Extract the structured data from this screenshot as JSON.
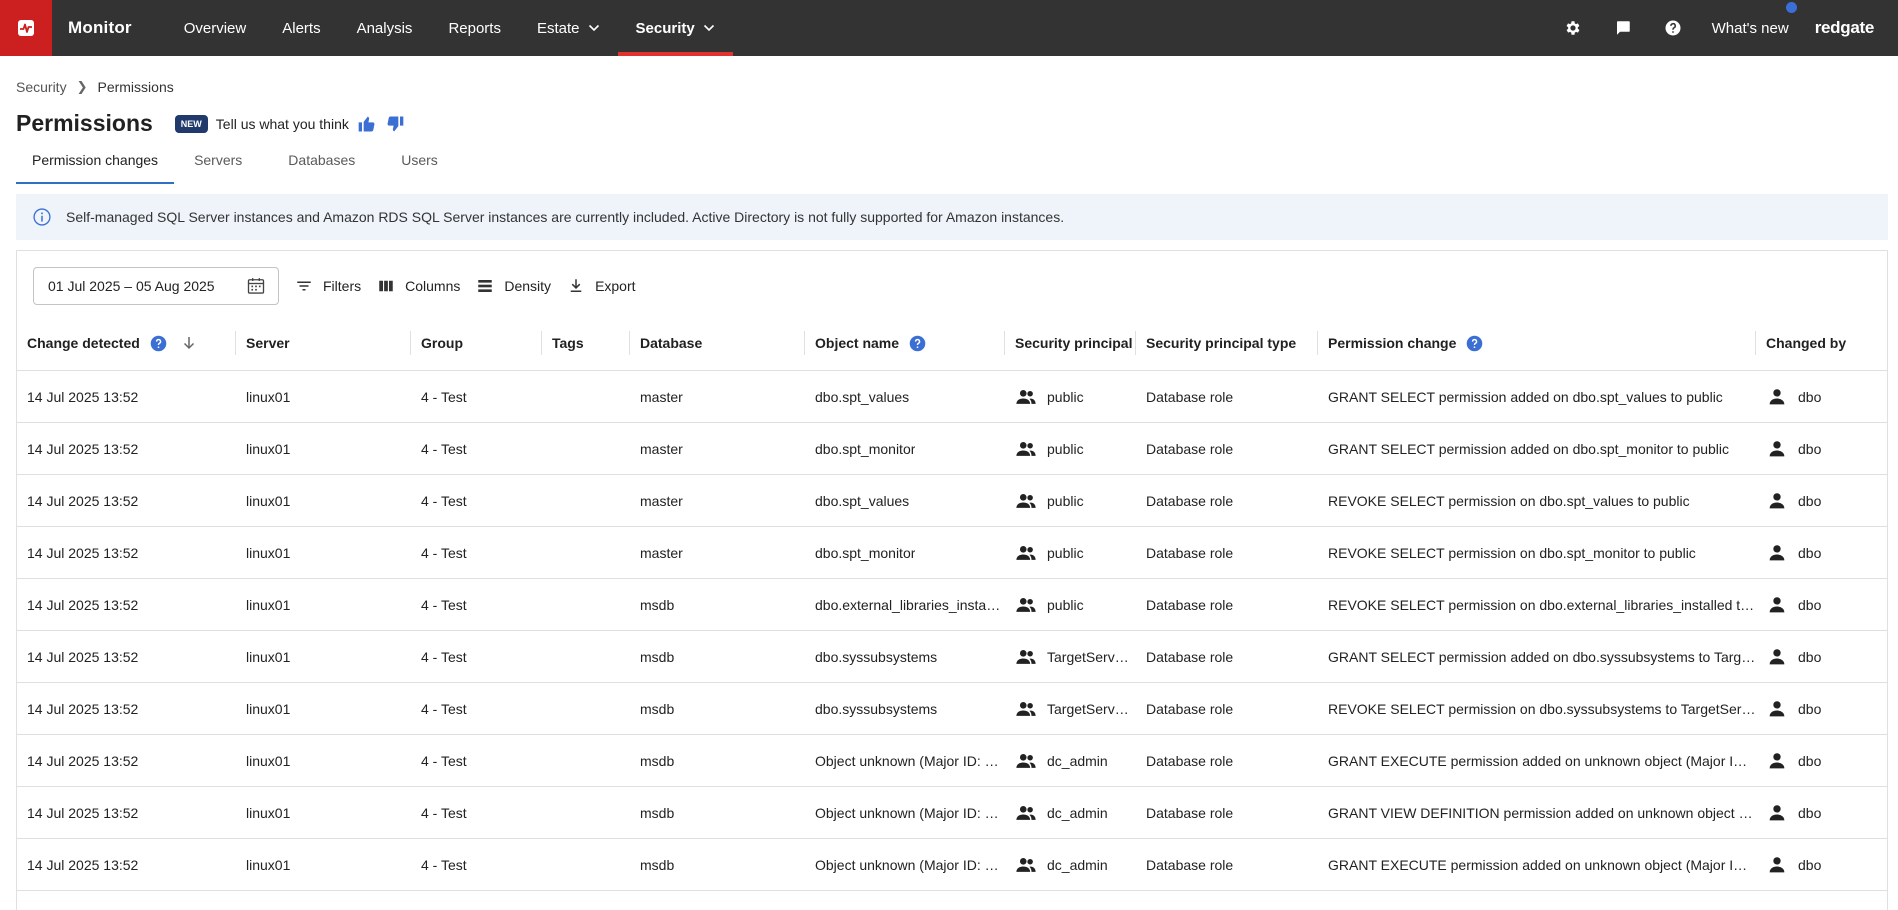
{
  "nav": {
    "brand": "Monitor",
    "items": [
      {
        "label": "Overview"
      },
      {
        "label": "Alerts"
      },
      {
        "label": "Analysis"
      },
      {
        "label": "Reports"
      },
      {
        "label": "Estate"
      },
      {
        "label": "Security"
      }
    ],
    "active": "Security",
    "whats_new": "What's new",
    "company": "redgate",
    "icons": [
      "gear-icon",
      "chat-icon",
      "help-icon"
    ],
    "colors": {
      "bar": "#333333",
      "logo": "#cc1f1f",
      "active_underline": "#e0322e",
      "notify_dot": "#3a6fd8"
    }
  },
  "breadcrumb": {
    "parent": "Security",
    "current": "Permissions"
  },
  "header": {
    "title": "Permissions",
    "badge": "NEW",
    "feedback": "Tell us what you think"
  },
  "tabs": [
    {
      "label": "Permission changes"
    },
    {
      "label": "Servers"
    },
    {
      "label": "Databases"
    },
    {
      "label": "Users"
    }
  ],
  "active_tab": "Permission changes",
  "banner": {
    "text": "Self-managed SQL Server instances and Amazon RDS SQL Server instances are currently included. Active Directory is not fully supported for Amazon instances."
  },
  "toolbar": {
    "date_range": "01 Jul 2025 – 05 Aug 2025",
    "filters": "Filters",
    "columns": "Columns",
    "density": "Density",
    "export": "Export"
  },
  "table": {
    "columns": [
      "Change detected",
      "Server",
      "Group",
      "Tags",
      "Database",
      "Object name",
      "Security principal",
      "Security principal type",
      "Permission change",
      "Changed by"
    ],
    "rows": [
      [
        "14 Jul 2025 13:52",
        "linux01",
        "4 - Test",
        "",
        "master",
        "dbo.spt_values",
        "public",
        "Database role",
        "GRANT SELECT permission added on dbo.spt_values to public",
        "dbo"
      ],
      [
        "14 Jul 2025 13:52",
        "linux01",
        "4 - Test",
        "",
        "master",
        "dbo.spt_monitor",
        "public",
        "Database role",
        "GRANT SELECT permission added on dbo.spt_monitor to public",
        "dbo"
      ],
      [
        "14 Jul 2025 13:52",
        "linux01",
        "4 - Test",
        "",
        "master",
        "dbo.spt_values",
        "public",
        "Database role",
        "REVOKE SELECT permission on dbo.spt_values to public",
        "dbo"
      ],
      [
        "14 Jul 2025 13:52",
        "linux01",
        "4 - Test",
        "",
        "master",
        "dbo.spt_monitor",
        "public",
        "Database role",
        "REVOKE SELECT permission on dbo.spt_monitor to public",
        "dbo"
      ],
      [
        "14 Jul 2025 13:52",
        "linux01",
        "4 - Test",
        "",
        "msdb",
        "dbo.external_libraries_insta…",
        "public",
        "Database role",
        "REVOKE SELECT permission on dbo.external_libraries_installed to…",
        "dbo"
      ],
      [
        "14 Jul 2025 13:52",
        "linux01",
        "4 - Test",
        "",
        "msdb",
        "dbo.syssubsystems",
        "TargetServersRole",
        "Database role",
        "GRANT SELECT permission added on dbo.syssubsystems to Targ…",
        "dbo"
      ],
      [
        "14 Jul 2025 13:52",
        "linux01",
        "4 - Test",
        "",
        "msdb",
        "dbo.syssubsystems",
        "TargetServersRole",
        "Database role",
        "REVOKE SELECT permission on dbo.syssubsystems to TargetSer…",
        "dbo"
      ],
      [
        "14 Jul 2025 13:52",
        "linux01",
        "4 - Test",
        "",
        "msdb",
        "Object unknown (Major ID: …",
        "dc_admin",
        "Database role",
        "GRANT EXECUTE permission added on unknown object (Major ID…",
        "dbo"
      ],
      [
        "14 Jul 2025 13:52",
        "linux01",
        "4 - Test",
        "",
        "msdb",
        "Object unknown (Major ID: …",
        "dc_admin",
        "Database role",
        "GRANT VIEW DEFINITION permission added on unknown object (…",
        "dbo"
      ],
      [
        "14 Jul 2025 13:52",
        "linux01",
        "4 - Test",
        "",
        "msdb",
        "Object unknown (Major ID: …",
        "dc_admin",
        "Database role",
        "GRANT EXECUTE permission added on unknown object (Major ID…",
        "dbo"
      ]
    ]
  }
}
